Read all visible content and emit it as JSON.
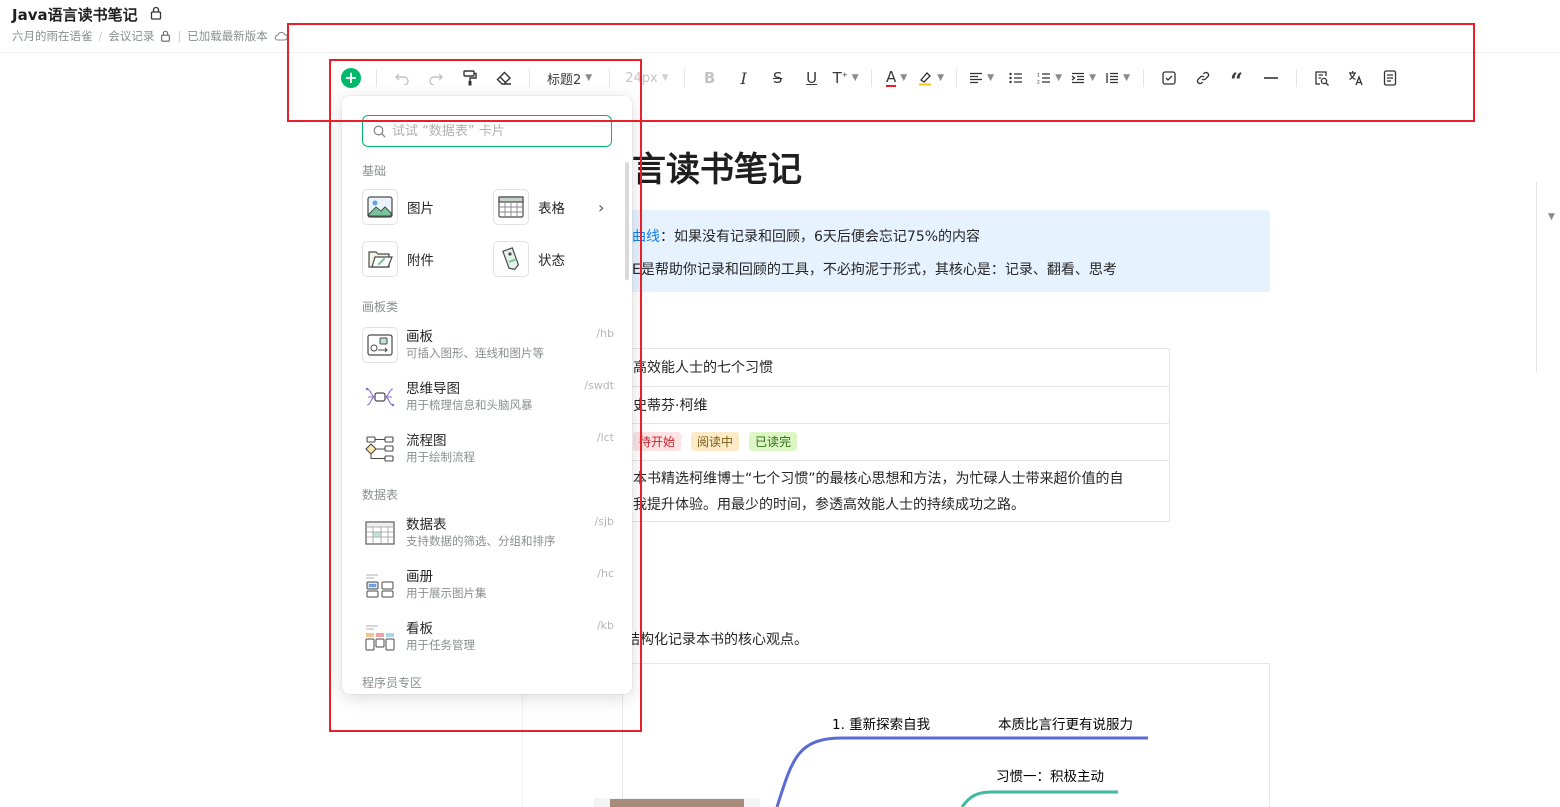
{
  "header": {
    "title": "Java语言读书笔记",
    "breadcrumb": [
      "六月的雨在语雀",
      "会议记录"
    ],
    "status": "已加载最新版本"
  },
  "toolbar": {
    "heading": "标题2",
    "font_size": "24px"
  },
  "document": {
    "title_partial": "言读书笔记",
    "callout_highlight": "曲线",
    "callout_line1": "：如果没有记录和回顾，6天后便会忘记75%的内容",
    "callout_line2": "E是帮助你记录和回顾的工具，不必拘泥于形式，其核心是：记录、翻看、思考",
    "table": {
      "book": "高效能人士的七个习惯",
      "author": "史蒂芬·柯维",
      "tags": [
        {
          "label": "待开始",
          "bg": "#fde3e4",
          "fg": "#c2262d"
        },
        {
          "label": "阅读中",
          "bg": "#fdebc8",
          "fg": "#7b5a13"
        },
        {
          "label": "已读完",
          "bg": "#dcf6c4",
          "fg": "#2f6b13"
        }
      ],
      "summary_line1": "本书精选柯维博士“七个习惯”的最核心思想和方法，为忙碌人士带来超价值的自",
      "summary_line2": "我提升体验。用最少的时间，参透高效能人士的持续成功之路。"
    },
    "intro": "结构化记录本书的核心观点。",
    "mindmap": {
      "node1": "1. 重新探索自我",
      "node2": "本质比言行更有说服力",
      "node3": "习惯一：积极主动",
      "line_colors": [
        "#5b6bd5",
        "#3dbaa2"
      ]
    }
  },
  "panel": {
    "search_placeholder": "试试 “数据表” 卡片",
    "sections": {
      "basic": "基础",
      "board": "画板类",
      "table": "数据表",
      "dev": "程序员专区"
    },
    "basic_items": [
      {
        "label": "图片",
        "icon": "image-icon"
      },
      {
        "label": "表格",
        "icon": "table-icon"
      },
      {
        "label": "附件",
        "icon": "attachment-icon"
      },
      {
        "label": "状态",
        "icon": "status-tag-icon"
      }
    ],
    "board_items": [
      {
        "title": "画板",
        "desc": "可插入图形、连线和图片等",
        "shortcut": "/hb",
        "icon": "whiteboard-icon"
      },
      {
        "title": "思维导图",
        "desc": "用于梳理信息和头脑风暴",
        "shortcut": "/swdt",
        "icon": "mindmap-icon"
      },
      {
        "title": "流程图",
        "desc": "用于绘制流程",
        "shortcut": "/lct",
        "icon": "flowchart-icon"
      }
    ],
    "table_items": [
      {
        "title": "数据表",
        "desc": "支持数据的筛选、分组和排序",
        "shortcut": "/sjb",
        "icon": "datatable-icon"
      },
      {
        "title": "画册",
        "desc": "用于展示图片集",
        "shortcut": "/hc",
        "icon": "gallery-icon"
      },
      {
        "title": "看板",
        "desc": "用于任务管理",
        "shortcut": "/kb",
        "icon": "kanban-icon"
      }
    ]
  },
  "colors": {
    "accent": "#00b96b",
    "annotation_red": "#e8202a",
    "callout_bg": "#e6f3ff"
  }
}
